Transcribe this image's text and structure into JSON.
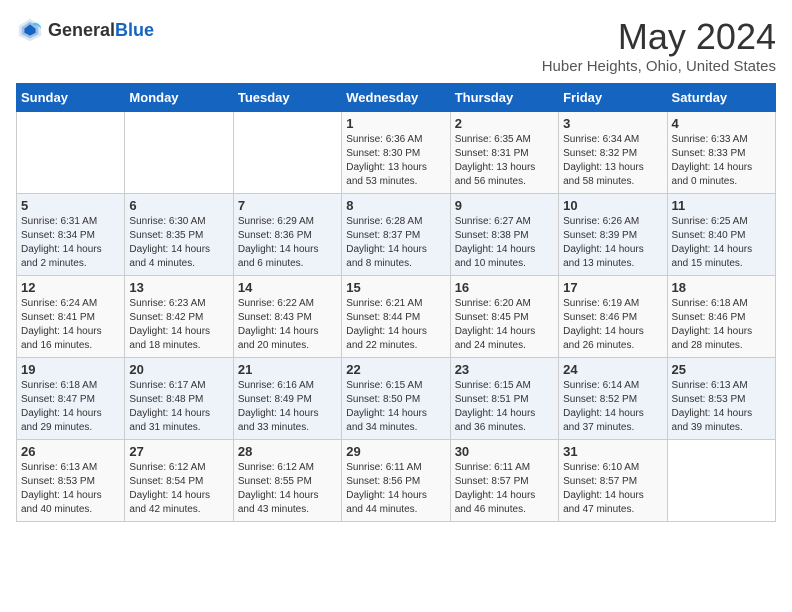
{
  "header": {
    "logo_general": "General",
    "logo_blue": "Blue",
    "month_title": "May 2024",
    "location": "Huber Heights, Ohio, United States"
  },
  "days_of_week": [
    "Sunday",
    "Monday",
    "Tuesday",
    "Wednesday",
    "Thursday",
    "Friday",
    "Saturday"
  ],
  "weeks": [
    [
      {
        "day": "",
        "info": ""
      },
      {
        "day": "",
        "info": ""
      },
      {
        "day": "",
        "info": ""
      },
      {
        "day": "1",
        "info": "Sunrise: 6:36 AM\nSunset: 8:30 PM\nDaylight: 13 hours\nand 53 minutes."
      },
      {
        "day": "2",
        "info": "Sunrise: 6:35 AM\nSunset: 8:31 PM\nDaylight: 13 hours\nand 56 minutes."
      },
      {
        "day": "3",
        "info": "Sunrise: 6:34 AM\nSunset: 8:32 PM\nDaylight: 13 hours\nand 58 minutes."
      },
      {
        "day": "4",
        "info": "Sunrise: 6:33 AM\nSunset: 8:33 PM\nDaylight: 14 hours\nand 0 minutes."
      }
    ],
    [
      {
        "day": "5",
        "info": "Sunrise: 6:31 AM\nSunset: 8:34 PM\nDaylight: 14 hours\nand 2 minutes."
      },
      {
        "day": "6",
        "info": "Sunrise: 6:30 AM\nSunset: 8:35 PM\nDaylight: 14 hours\nand 4 minutes."
      },
      {
        "day": "7",
        "info": "Sunrise: 6:29 AM\nSunset: 8:36 PM\nDaylight: 14 hours\nand 6 minutes."
      },
      {
        "day": "8",
        "info": "Sunrise: 6:28 AM\nSunset: 8:37 PM\nDaylight: 14 hours\nand 8 minutes."
      },
      {
        "day": "9",
        "info": "Sunrise: 6:27 AM\nSunset: 8:38 PM\nDaylight: 14 hours\nand 10 minutes."
      },
      {
        "day": "10",
        "info": "Sunrise: 6:26 AM\nSunset: 8:39 PM\nDaylight: 14 hours\nand 13 minutes."
      },
      {
        "day": "11",
        "info": "Sunrise: 6:25 AM\nSunset: 8:40 PM\nDaylight: 14 hours\nand 15 minutes."
      }
    ],
    [
      {
        "day": "12",
        "info": "Sunrise: 6:24 AM\nSunset: 8:41 PM\nDaylight: 14 hours\nand 16 minutes."
      },
      {
        "day": "13",
        "info": "Sunrise: 6:23 AM\nSunset: 8:42 PM\nDaylight: 14 hours\nand 18 minutes."
      },
      {
        "day": "14",
        "info": "Sunrise: 6:22 AM\nSunset: 8:43 PM\nDaylight: 14 hours\nand 20 minutes."
      },
      {
        "day": "15",
        "info": "Sunrise: 6:21 AM\nSunset: 8:44 PM\nDaylight: 14 hours\nand 22 minutes."
      },
      {
        "day": "16",
        "info": "Sunrise: 6:20 AM\nSunset: 8:45 PM\nDaylight: 14 hours\nand 24 minutes."
      },
      {
        "day": "17",
        "info": "Sunrise: 6:19 AM\nSunset: 8:46 PM\nDaylight: 14 hours\nand 26 minutes."
      },
      {
        "day": "18",
        "info": "Sunrise: 6:18 AM\nSunset: 8:46 PM\nDaylight: 14 hours\nand 28 minutes."
      }
    ],
    [
      {
        "day": "19",
        "info": "Sunrise: 6:18 AM\nSunset: 8:47 PM\nDaylight: 14 hours\nand 29 minutes."
      },
      {
        "day": "20",
        "info": "Sunrise: 6:17 AM\nSunset: 8:48 PM\nDaylight: 14 hours\nand 31 minutes."
      },
      {
        "day": "21",
        "info": "Sunrise: 6:16 AM\nSunset: 8:49 PM\nDaylight: 14 hours\nand 33 minutes."
      },
      {
        "day": "22",
        "info": "Sunrise: 6:15 AM\nSunset: 8:50 PM\nDaylight: 14 hours\nand 34 minutes."
      },
      {
        "day": "23",
        "info": "Sunrise: 6:15 AM\nSunset: 8:51 PM\nDaylight: 14 hours\nand 36 minutes."
      },
      {
        "day": "24",
        "info": "Sunrise: 6:14 AM\nSunset: 8:52 PM\nDaylight: 14 hours\nand 37 minutes."
      },
      {
        "day": "25",
        "info": "Sunrise: 6:13 AM\nSunset: 8:53 PM\nDaylight: 14 hours\nand 39 minutes."
      }
    ],
    [
      {
        "day": "26",
        "info": "Sunrise: 6:13 AM\nSunset: 8:53 PM\nDaylight: 14 hours\nand 40 minutes."
      },
      {
        "day": "27",
        "info": "Sunrise: 6:12 AM\nSunset: 8:54 PM\nDaylight: 14 hours\nand 42 minutes."
      },
      {
        "day": "28",
        "info": "Sunrise: 6:12 AM\nSunset: 8:55 PM\nDaylight: 14 hours\nand 43 minutes."
      },
      {
        "day": "29",
        "info": "Sunrise: 6:11 AM\nSunset: 8:56 PM\nDaylight: 14 hours\nand 44 minutes."
      },
      {
        "day": "30",
        "info": "Sunrise: 6:11 AM\nSunset: 8:57 PM\nDaylight: 14 hours\nand 46 minutes."
      },
      {
        "day": "31",
        "info": "Sunrise: 6:10 AM\nSunset: 8:57 PM\nDaylight: 14 hours\nand 47 minutes."
      },
      {
        "day": "",
        "info": ""
      }
    ]
  ]
}
